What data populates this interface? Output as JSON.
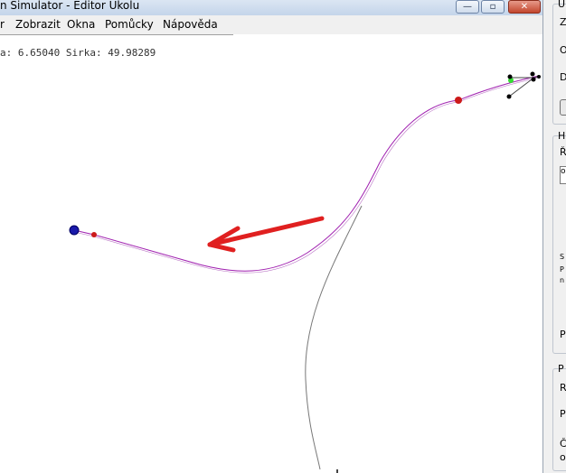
{
  "window": {
    "title": "n Simulator - Editor Úkolu",
    "minimize_glyph": "—",
    "maximize_glyph": "▫",
    "close_glyph": "✕"
  },
  "menu": {
    "items": [
      "r",
      "Zobrazit",
      "Okna",
      "Pomůcky",
      "Nápověda"
    ]
  },
  "status": {
    "coords": "a: 6.65040 Sirka: 49.98289"
  },
  "map": {
    "icons": [
      "waypoint-marker-icon",
      "route-start-icon",
      "direction-arrow-icon"
    ],
    "colors": {
      "route": "#a020b0",
      "ground_track": "#777777",
      "waypoint": "#cc1a1a",
      "start": "#1a1aaa",
      "arrow": "#e02020",
      "highlight": "#33dd33"
    }
  },
  "panel": {
    "group1_header": "U",
    "group1_lines": [
      "Z",
      "O",
      "D"
    ],
    "group2_header": "H",
    "group2_line": "Ř",
    "group2_field": "o",
    "group2_notes": [
      "S",
      "P",
      "n"
    ],
    "group2_footer": "P",
    "group3_header": "P",
    "group3_lines": [
      "R",
      "P"
    ],
    "group3_bottom": [
      "Č",
      "o"
    ]
  }
}
